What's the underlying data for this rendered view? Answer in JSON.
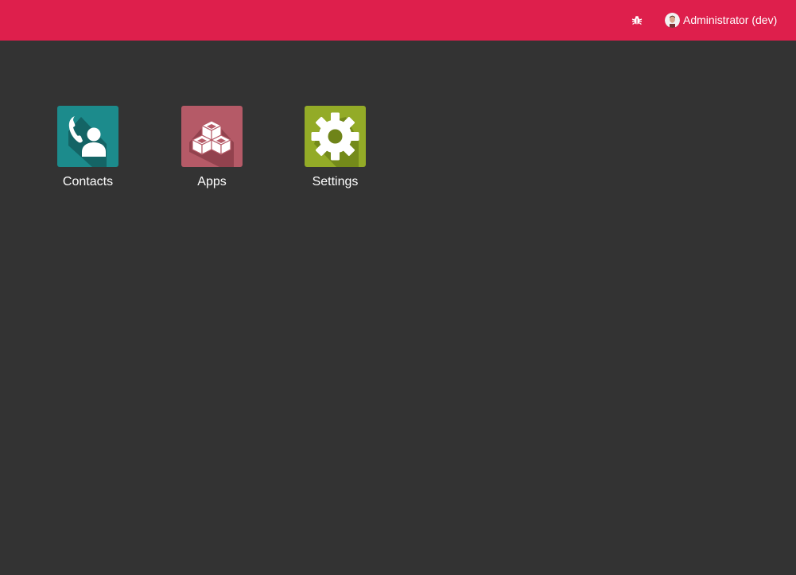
{
  "topbar": {
    "color": "#de1f4c",
    "debug_icon": "bug-icon",
    "user_label": "Administrator (dev)"
  },
  "apps": [
    {
      "label": "Contacts",
      "icon": "contacts-phone-person-icon",
      "color": "#1c8b8c"
    },
    {
      "label": "Apps",
      "icon": "cubes-icon",
      "color": "#b55a67"
    },
    {
      "label": "Settings",
      "icon": "gear-icon",
      "color": "#93ab27"
    }
  ],
  "background_color": "#333333"
}
